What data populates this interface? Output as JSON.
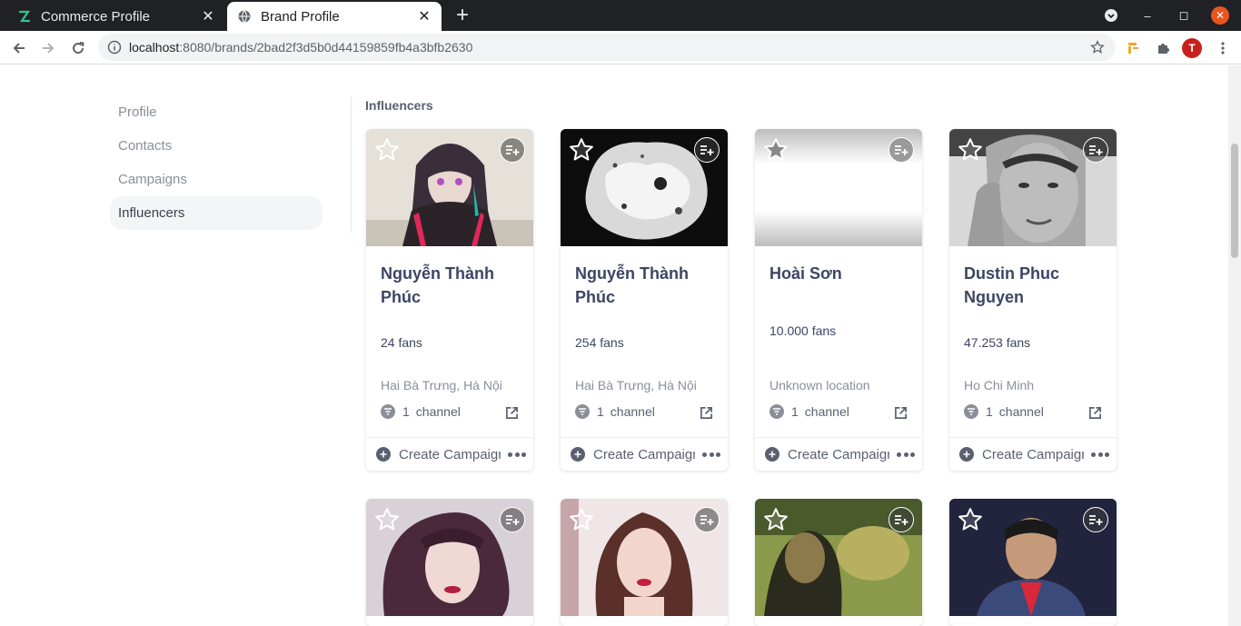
{
  "browser": {
    "tabs": [
      {
        "title": "Commerce Profile",
        "active": false,
        "icon": "app-favicon"
      },
      {
        "title": "Brand Profile",
        "active": true,
        "icon": "globe-icon"
      }
    ],
    "url_host": "localhost",
    "url_path": ":8080/brands/2bad2f3d5b0d44159859fb4a3bfb2630",
    "profile_initial": "T"
  },
  "sidebar": {
    "items": [
      {
        "label": "Profile",
        "active": false
      },
      {
        "label": "Contacts",
        "active": false
      },
      {
        "label": "Campaigns",
        "active": false
      },
      {
        "label": "Influencers",
        "active": true
      }
    ]
  },
  "section_title": "Influencers",
  "influencers": [
    {
      "name": "Nguyễn Thành Phúc",
      "fans": "24 fans",
      "location": "Hai Bà Trưng, Hà Nội",
      "channel_count": "1",
      "channel_label": "channel",
      "action": "Create Campaign"
    },
    {
      "name": "Nguyễn Thành Phúc",
      "fans": "254 fans",
      "location": "Hai Bà Trưng, Hà Nội",
      "channel_count": "1",
      "channel_label": "channel",
      "action": "Create Campaign"
    },
    {
      "name": "Hoài Sơn",
      "fans": "10.000 fans",
      "location": "Unknown location",
      "channel_count": "1",
      "channel_label": "channel",
      "action": "Create Campaign"
    },
    {
      "name": "Dustin Phuc Nguyen",
      "fans": "47.253 fans",
      "location": "Ho Chi Minh",
      "channel_count": "1",
      "channel_label": "channel",
      "action": "Create Campaign"
    }
  ],
  "colors": {
    "accent": "#3d4564",
    "muted": "#8a8f98",
    "active_nav_bg": "#f4f5f7",
    "chrome_dark": "#202124"
  }
}
